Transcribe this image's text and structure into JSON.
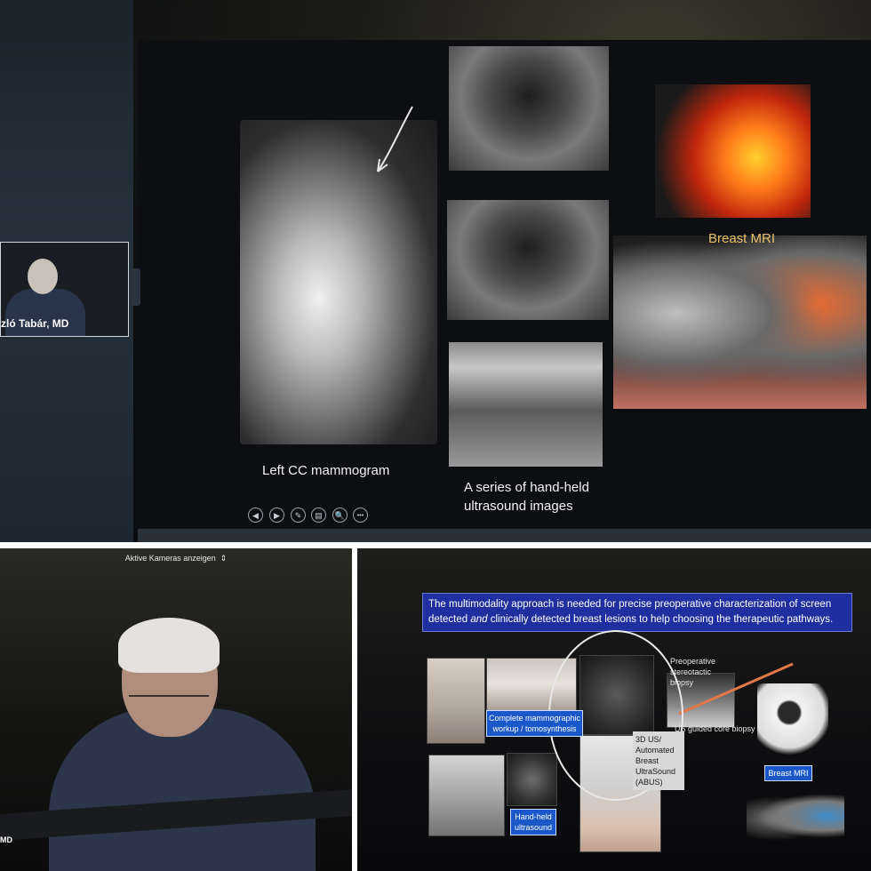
{
  "top_panel": {
    "slide": {
      "labels": {
        "mammogram": "Left CC mammogram",
        "ultrasound_line1": "A series of hand-held",
        "ultrasound_line2": "ultrasound images",
        "mri": "Breast MRI"
      },
      "controls": [
        "◀",
        "▶",
        "✎",
        "▤",
        "🔍",
        "•••"
      ]
    },
    "speaker_thumb": {
      "name": "zló Tabár, MD"
    }
  },
  "bottom_left_panel": {
    "header": "Aktive Kameras anzeigen",
    "name_fragment": "MD"
  },
  "bottom_right_panel": {
    "intro_line1": "The multimodality approach is needed for precise preoperative characterization of screen",
    "intro_line2_pre": "detected ",
    "intro_line2_em": "and",
    "intro_line2_post": " clinically detected breast lesions to help choosing the therapeutic pathways.",
    "labels": {
      "mammo_workup_1": "Complete mammographic",
      "mammo_workup_2": "workup / tomosynthesis",
      "stereo_1": "Preoperative",
      "stereo_2": "stereotactic",
      "stereo_3": "biopsy",
      "us_biopsy": "US guided core biopsy",
      "abus_1": "3D US/",
      "abus_2": "Automated",
      "abus_3": "Breast",
      "abus_4": "UltraSound",
      "abus_5": "(ABUS)",
      "handheld_1": "Hand-held",
      "handheld_2": "ultrasound",
      "breast_mri": "Breast MRI"
    }
  }
}
